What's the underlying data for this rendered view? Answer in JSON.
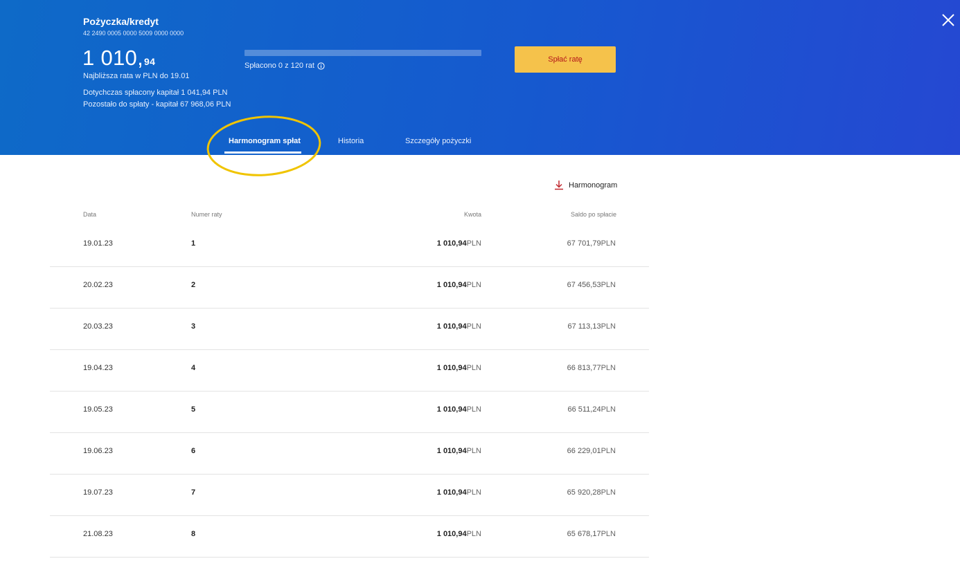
{
  "header": {
    "title": "Pożyczka/kredyt",
    "account_number": "42 2490 0005 0000 5009 0000 0000",
    "amount_main": "1 010,",
    "amount_decimal": "94",
    "next_rate": "Najbliższa rata w PLN do 19.01",
    "paid_capital": "Dotychczas spłacony kapitał 1 041,94 PLN",
    "remaining": "Pozostało do spłaty - kapitał 67 968,06 PLN",
    "progress_text": "Spłacono 0 z 120 rat",
    "progress_fraction": 0,
    "pay_button": "Spłać ratę",
    "close_icon": "close-icon",
    "info_icon": "info-icon"
  },
  "colors": {
    "header_start": "#0e6ac8",
    "header_end": "#2548d2",
    "pay_button_bg": "#f5c24b",
    "pay_button_text": "#b4151b",
    "highlight": "#f0c400"
  },
  "tabs": [
    {
      "label": "Harmonogram spłat",
      "active": true
    },
    {
      "label": "Historia",
      "active": false
    },
    {
      "label": "Szczegóły pożyczki",
      "active": false
    }
  ],
  "download": {
    "label": "Harmonogram",
    "icon": "download-icon"
  },
  "table": {
    "columns": [
      "Data",
      "Numer raty",
      "Kwota",
      "Saldo po spłacie"
    ],
    "rows": [
      {
        "date": "19.01.23",
        "number": "1",
        "amount": "1 010,94",
        "currency": "PLN",
        "balance": "67 701,79"
      },
      {
        "date": "20.02.23",
        "number": "2",
        "amount": "1 010,94",
        "currency": "PLN",
        "balance": "67 456,53"
      },
      {
        "date": "20.03.23",
        "number": "3",
        "amount": "1 010,94",
        "currency": "PLN",
        "balance": "67 113,13"
      },
      {
        "date": "19.04.23",
        "number": "4",
        "amount": "1 010,94",
        "currency": "PLN",
        "balance": "66 813,77"
      },
      {
        "date": "19.05.23",
        "number": "5",
        "amount": "1 010,94",
        "currency": "PLN",
        "balance": "66 511,24"
      },
      {
        "date": "19.06.23",
        "number": "6",
        "amount": "1 010,94",
        "currency": "PLN",
        "balance": "66 229,01"
      },
      {
        "date": "19.07.23",
        "number": "7",
        "amount": "1 010,94",
        "currency": "PLN",
        "balance": "65 920,28"
      },
      {
        "date": "21.08.23",
        "number": "8",
        "amount": "1 010,94",
        "currency": "PLN",
        "balance": "65 678,17"
      }
    ]
  }
}
